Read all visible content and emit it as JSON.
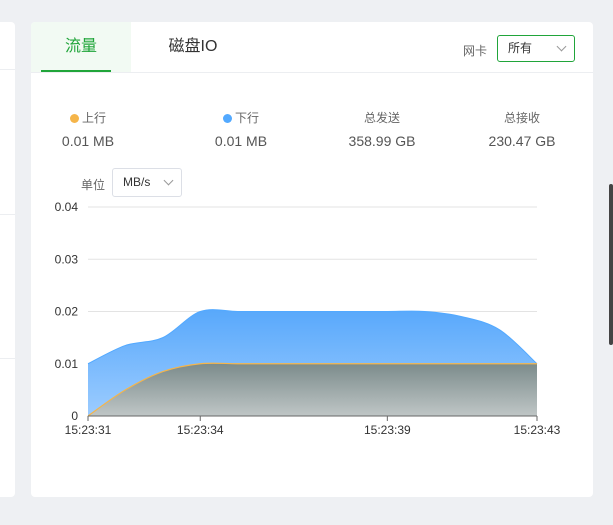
{
  "tabs": [
    {
      "label": "流量",
      "active": true
    },
    {
      "label": "磁盘IO",
      "active": false
    }
  ],
  "nic": {
    "label": "网卡",
    "selected": "所有"
  },
  "stats": [
    {
      "label": "上行",
      "value": "0.01 MB",
      "dot_color": "#f5b54a"
    },
    {
      "label": "下行",
      "value": "0.01 MB",
      "dot_color": "#52a9ff"
    },
    {
      "label": "总发送",
      "value": "358.99 GB"
    },
    {
      "label": "总接收",
      "value": "230.47 GB"
    }
  ],
  "unit": {
    "label": "单位",
    "selected": "MB/s"
  },
  "colors": {
    "accent": "#20a53a",
    "upstream": "#f5b54a",
    "downstream": "#52a9ff"
  },
  "chart_data": {
    "type": "area",
    "x": [
      "15:23:31",
      "15:23:32",
      "15:23:33",
      "15:23:34",
      "15:23:35",
      "15:23:36",
      "15:23:37",
      "15:23:38",
      "15:23:39",
      "15:23:40",
      "15:23:41",
      "15:23:42",
      "15:23:43"
    ],
    "x_ticks": [
      "15:23:31",
      "15:23:34",
      "15:23:39",
      "15:23:43"
    ],
    "y_ticks": [
      "0",
      "0.01",
      "0.02",
      "0.03",
      "0.04"
    ],
    "ylim": [
      0,
      0.04
    ],
    "grid": true,
    "stacked": true,
    "series": [
      {
        "name": "上行",
        "values": [
          0,
          0.005,
          0.0085,
          0.01,
          0.01,
          0.01,
          0.01,
          0.01,
          0.01,
          0.01,
          0.01,
          0.01,
          0.01
        ]
      },
      {
        "name": "下行",
        "values": [
          0.01,
          0.0085,
          0.0065,
          0.01,
          0.01,
          0.01,
          0.01,
          0.01,
          0.01,
          0.01,
          0.009,
          0.0065,
          0
        ]
      }
    ]
  }
}
